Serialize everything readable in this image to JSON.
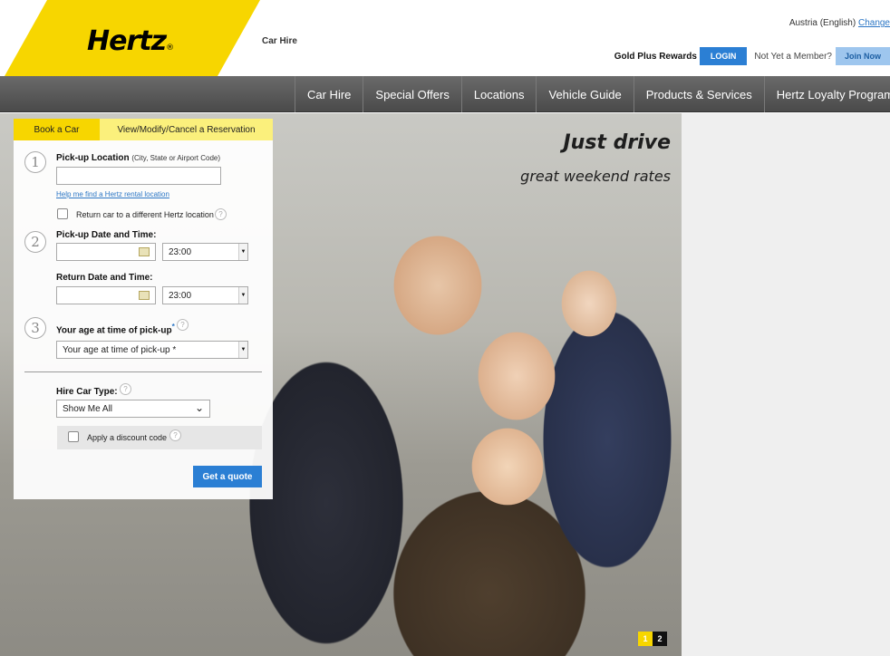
{
  "header": {
    "logo_text": "Hertz",
    "logo_mark": "®",
    "car_hire_label": "Car Hire",
    "locale_text": "Austria  (English)",
    "change_link": "Change",
    "gold_plus_label": "Gold Plus Rewards",
    "login_label": "LOGIN",
    "not_member_label": "Not Yet a Member?",
    "join_label": "Join Now",
    "brand_yellow": "#f7d600"
  },
  "nav": {
    "items": [
      {
        "label": "Car Hire"
      },
      {
        "label": "Special Offers"
      },
      {
        "label": "Locations"
      },
      {
        "label": "Vehicle Guide"
      },
      {
        "label": "Products & Services"
      },
      {
        "label": "Hertz Loyalty Programme"
      }
    ]
  },
  "hero": {
    "title": "Just drive",
    "subtitle": "great weekend rates",
    "slides": [
      {
        "label": "1",
        "active": true
      },
      {
        "label": "2",
        "active": false
      }
    ]
  },
  "booking": {
    "tabs": {
      "book": "Book a Car",
      "modify": "View/Modify/Cancel a Reservation"
    },
    "step1": {
      "number": "1",
      "label": "Pick-up Location",
      "hint": "(City, State or Airport Code)",
      "value": "",
      "help_link": "Help me find a Hertz rental location",
      "return_checkbox_label": "Return car to a different Hertz location"
    },
    "step2": {
      "number": "2",
      "pickup_label": "Pick-up Date and Time:",
      "pickup_date": "",
      "pickup_time": "23:00",
      "return_label": "Return Date and Time:",
      "return_date": "",
      "return_time": "23:00"
    },
    "step3": {
      "number": "3",
      "label": "Your age at time of pick-up",
      "required_mark": "*",
      "select_value": "Your age at time of pick-up *"
    },
    "car_type": {
      "label": "Hire Car Type:",
      "value": "Show Me All"
    },
    "discount_label": "Apply a discount code",
    "help_glyph": "?",
    "submit_label": "Get a quote"
  }
}
